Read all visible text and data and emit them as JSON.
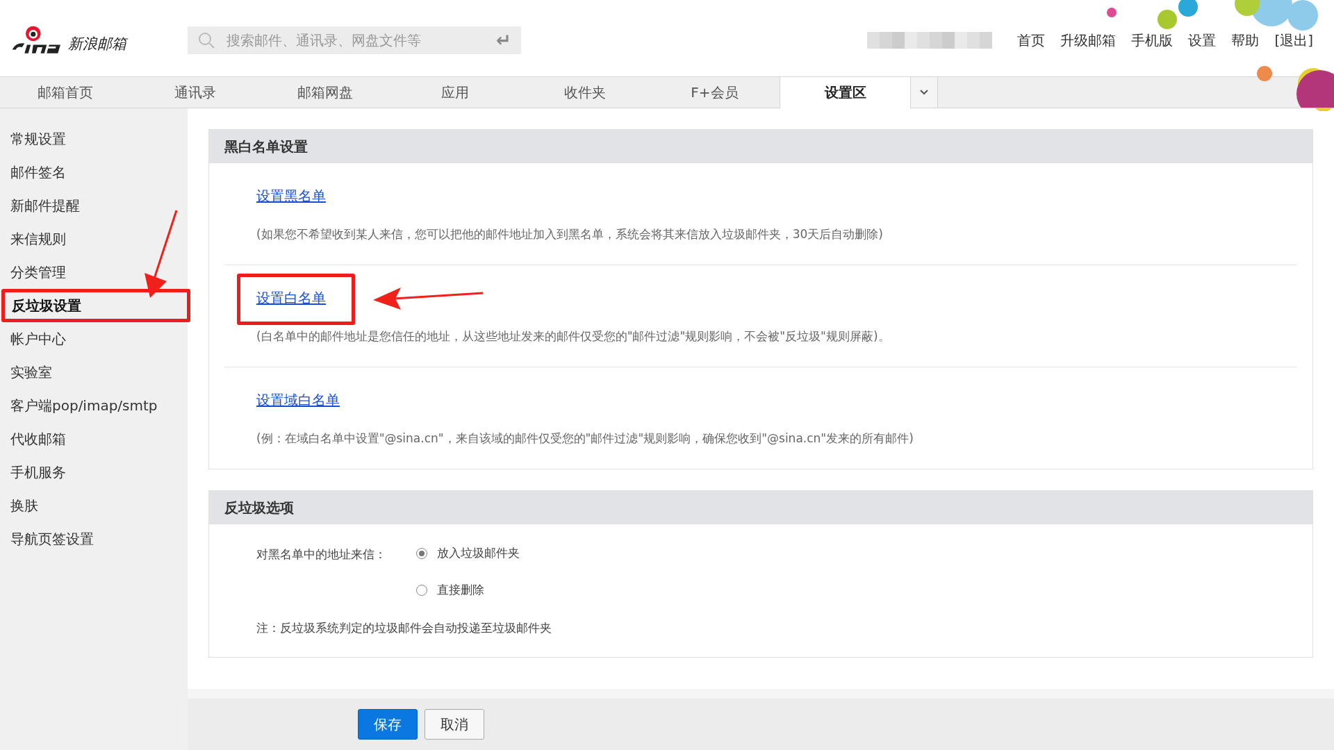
{
  "header": {
    "logo_text": "新浪邮箱",
    "search": {
      "placeholder": "搜索邮件、通讯录、网盘文件等",
      "enter_key": "↵"
    },
    "links": [
      "首页",
      "升级邮箱",
      "手机版",
      "设置",
      "帮助",
      "[退出]"
    ]
  },
  "tabs": [
    {
      "label": "邮箱首页",
      "selected": false
    },
    {
      "label": "通讯录",
      "selected": false
    },
    {
      "label": "邮箱网盘",
      "selected": false
    },
    {
      "label": "应用",
      "selected": false
    },
    {
      "label": "收件夹",
      "selected": false
    },
    {
      "label": "F+会员",
      "selected": false
    },
    {
      "label": "设置区",
      "selected": true
    }
  ],
  "sidebar": {
    "items": [
      {
        "label": "常规设置",
        "selected": false
      },
      {
        "label": "邮件签名",
        "selected": false
      },
      {
        "label": "新邮件提醒",
        "selected": false
      },
      {
        "label": "来信规则",
        "selected": false
      },
      {
        "label": "分类管理",
        "selected": false
      },
      {
        "label": "反垃圾设置",
        "selected": true
      },
      {
        "label": "帐户中心",
        "selected": false
      },
      {
        "label": "实验室",
        "selected": false
      },
      {
        "label": "客户端pop/imap/smtp",
        "selected": false
      },
      {
        "label": "代收邮箱",
        "selected": false
      },
      {
        "label": "手机服务",
        "selected": false
      },
      {
        "label": "换肤",
        "selected": false
      },
      {
        "label": "导航页签设置",
        "selected": false
      }
    ]
  },
  "list_section": {
    "title": "黑白名单设置",
    "entries": [
      {
        "link": "设置黑名单",
        "description": "(如果您不希望收到某人来信，您可以把他的邮件地址加入到黑名单，系统会将其来信放入垃圾邮件夹，30天后自动删除)"
      },
      {
        "link": "设置白名单",
        "description": "(白名单中的邮件地址是您信任的地址，从这些地址发来的邮件仅受您的\"邮件过滤\"规则影响，不会被\"反垃圾\"规则屏蔽)。"
      },
      {
        "link": "设置域白名单",
        "description": "(例：在域白名单中设置\"@sina.cn\"，来自该域的邮件仅受您的\"邮件过滤\"规则影响，确保您收到\"@sina.cn\"发来的所有邮件)"
      }
    ]
  },
  "spam_section": {
    "title": "反垃圾选项",
    "label": "对黑名单中的地址来信：",
    "options": [
      {
        "label": "放入垃圾邮件夹",
        "selected": true
      },
      {
        "label": "直接删除",
        "selected": false
      }
    ],
    "note": "注：反垃圾系统判定的垃圾邮件会自动投递至垃圾邮件夹"
  },
  "buttons": [
    {
      "label": "保存",
      "kind": "primary"
    },
    {
      "label": "取消",
      "kind": "secondary"
    }
  ]
}
